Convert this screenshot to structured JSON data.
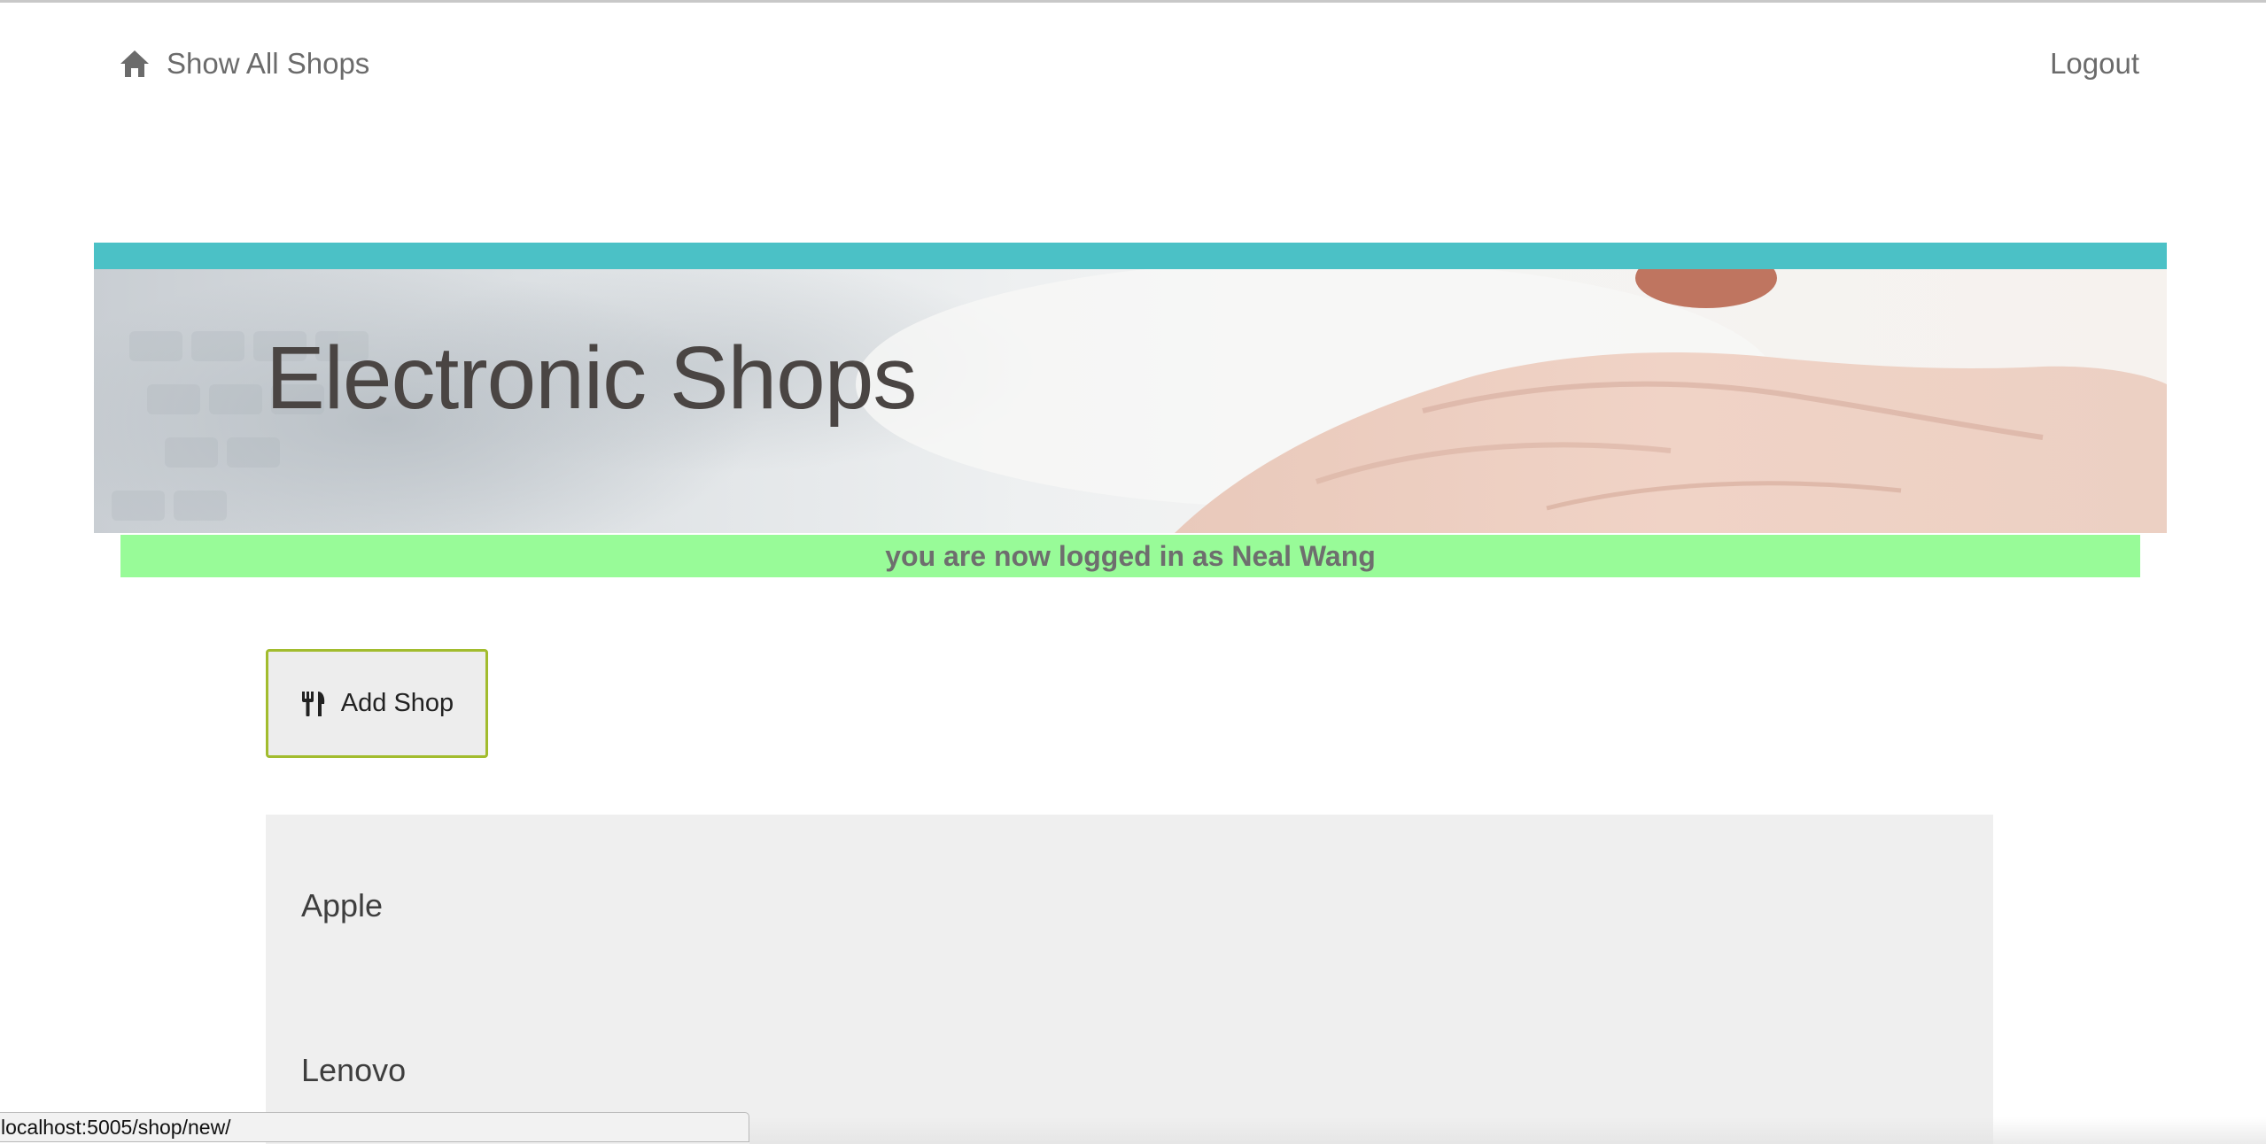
{
  "nav": {
    "home_label": "Show All Shops",
    "home_icon": "home-icon",
    "logout_label": "Logout"
  },
  "banner": {
    "title": "Electronic Shops",
    "accent_color": "#4bc1c6"
  },
  "flash": {
    "message": "you are now logged in as Neal Wang",
    "color": "#98fb98"
  },
  "actions": {
    "add_shop_label": "Add Shop",
    "add_shop_icon": "cutlery-icon",
    "border_color": "#a2bc2e"
  },
  "shops": [
    {
      "name": "Apple"
    },
    {
      "name": "Lenovo"
    }
  ],
  "status_bar": {
    "url": "localhost:5005/shop/new/"
  }
}
